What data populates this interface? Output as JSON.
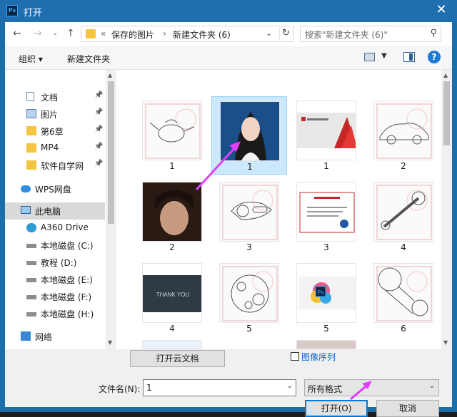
{
  "window": {
    "title": "打开",
    "app_icon": "Ps"
  },
  "nav": {
    "back": "←",
    "forward": "→",
    "up": "↑",
    "overflow": "«"
  },
  "address": {
    "crumbs": [
      "保存的图片",
      "新建文件夹 (6)"
    ],
    "separator": "›"
  },
  "search": {
    "placeholder": "搜索\"新建文件夹 (6)\""
  },
  "toolbar": {
    "organize": "组织 ▾",
    "new_folder": "新建文件夹",
    "help": "?"
  },
  "sidebar": {
    "items": [
      {
        "label": "文档",
        "icon": "document-icon",
        "pinned": true
      },
      {
        "label": "图片",
        "icon": "pictures-icon",
        "pinned": true
      },
      {
        "label": "第6章",
        "icon": "folder-icon",
        "pinned": true
      },
      {
        "label": "MP4",
        "icon": "folder-icon",
        "pinned": true
      },
      {
        "label": "软件自学网",
        "icon": "folder-icon",
        "pinned": true
      },
      {
        "label": "WPS网盘",
        "icon": "cloud-icon",
        "pinned": false
      },
      {
        "label": "此电脑",
        "icon": "computer-icon",
        "pinned": false,
        "selected": true
      },
      {
        "label": "A360 Drive",
        "icon": "a360-icon",
        "pinned": false
      },
      {
        "label": "本地磁盘 (C:)",
        "icon": "windows-drive-icon",
        "pinned": false
      },
      {
        "label": "教程 (D:)",
        "icon": "drive-icon",
        "pinned": false
      },
      {
        "label": "本地磁盘 (E:)",
        "icon": "drive-icon",
        "pinned": false
      },
      {
        "label": "本地磁盘 (F:)",
        "icon": "drive-icon",
        "pinned": false
      },
      {
        "label": "本地磁盘 (H:)",
        "icon": "drive-icon",
        "pinned": false
      },
      {
        "label": "网络",
        "icon": "network-icon",
        "pinned": false
      }
    ]
  },
  "files": [
    {
      "label": "1",
      "kind": "drawing-teapot"
    },
    {
      "label": "1",
      "kind": "portrait-woman",
      "selected": true
    },
    {
      "label": "1",
      "kind": "autocad-splash"
    },
    {
      "label": "2",
      "kind": "drawing-car"
    },
    {
      "label": "2",
      "kind": "photo-face"
    },
    {
      "label": "3",
      "kind": "drawing-part"
    },
    {
      "label": "3",
      "kind": "certificate"
    },
    {
      "label": "4",
      "kind": "drawing-lever"
    },
    {
      "label": "4",
      "kind": "thank-you"
    },
    {
      "label": "5",
      "kind": "drawing-gear"
    },
    {
      "label": "5",
      "kind": "ps-splash"
    },
    {
      "label": "6",
      "kind": "drawing-link"
    }
  ],
  "thumb_texts": {
    "thank_you": "THANK YOU",
    "ps": "Ps"
  },
  "bottom": {
    "open_cloud": "打开云文档",
    "image_sequence": "图像序列",
    "filename_label": "文件名(N):",
    "filename_value": "1",
    "filter_value": "所有格式",
    "open": "打开(O)",
    "cancel": "取消"
  },
  "colors": {
    "titlebar": "#1f6fb0",
    "selection": "#cce8ff",
    "annotation_arrow": "#e040fb",
    "link": "#0066cc"
  }
}
